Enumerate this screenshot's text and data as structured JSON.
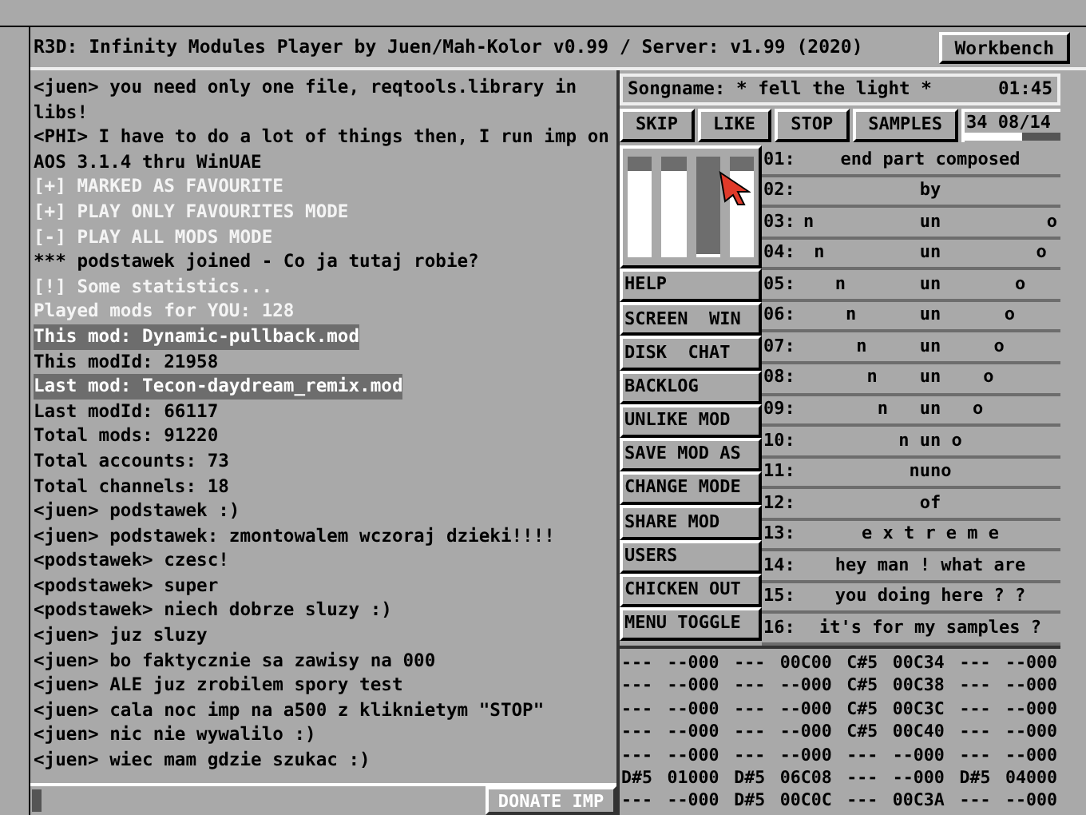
{
  "title_bar": {
    "title": "R3D: Infinity Modules Player by Juen/Mah-Kolor v0.99 / Server: v1.99 (2020)",
    "button": "Workbench"
  },
  "chat": {
    "lines": [
      {
        "kind": "normal",
        "text": "<juen> you need only one file, reqtools.library in libs!"
      },
      {
        "kind": "normal",
        "text": "<PHI> I have to do a lot of things then, I run imp on AOS 3.1.4 thru WinUAE"
      },
      {
        "kind": "system",
        "text": "[+] MARKED AS FAVOURITE"
      },
      {
        "kind": "system",
        "text": "[+] PLAY ONLY FAVOURITES MODE"
      },
      {
        "kind": "system",
        "text": "[-] PLAY ALL MODS MODE"
      },
      {
        "kind": "normal",
        "text": "*** podstawek joined - Co ja tutaj robie?"
      },
      {
        "kind": "system",
        "text": "[!] Some statistics..."
      },
      {
        "kind": "system",
        "text": "Played mods for YOU: 128"
      },
      {
        "kind": "highlight",
        "text": "This mod: Dynamic-pullback.mod"
      },
      {
        "kind": "normal",
        "text": "This modId: 21958"
      },
      {
        "kind": "highlight",
        "text": "Last mod: Tecon-daydream_remix.mod"
      },
      {
        "kind": "normal",
        "text": "Last modId: 66117"
      },
      {
        "kind": "normal",
        "text": "Total mods: 91220"
      },
      {
        "kind": "normal",
        "text": "Total accounts: 73"
      },
      {
        "kind": "normal",
        "text": "Total channels: 18"
      },
      {
        "kind": "normal",
        "text": "<juen> podstawek :)"
      },
      {
        "kind": "normal",
        "text": "<juen> podstawek: zmontowalem wczoraj dzieki!!!!"
      },
      {
        "kind": "normal",
        "text": "<podstawek> czesc!"
      },
      {
        "kind": "normal",
        "text": "<podstawek> super"
      },
      {
        "kind": "normal",
        "text": "<podstawek> niech dobrze sluzy :)"
      },
      {
        "kind": "normal",
        "text": "<juen> juz sluzy"
      },
      {
        "kind": "normal",
        "text": "<juen> bo faktycznie sa zawisy na 000"
      },
      {
        "kind": "normal",
        "text": "<juen> ALE juz zrobilem spory test"
      },
      {
        "kind": "normal",
        "text": "<juen> cala noc imp na a500 z kliknietym \"STOP\""
      },
      {
        "kind": "normal",
        "text": "<juen> nic nie wywalilo :)"
      },
      {
        "kind": "normal",
        "text": "<juen> wiec mam gdzie szukac :)"
      }
    ],
    "donate_button": "DONATE IMP"
  },
  "player": {
    "songname": "Songname: * fell the light *",
    "time": "01:45",
    "buttons": [
      "SKIP",
      "LIKE",
      "STOP",
      "SAMPLES"
    ],
    "position": {
      "text": "34 08/14",
      "level": 0.6
    },
    "meters": [
      {
        "level": 0.85
      },
      {
        "level": 0.85
      },
      {
        "level": 0
      },
      {
        "level": 0.85
      }
    ],
    "menu": [
      "HELP",
      "SCREEN  WIN",
      "DISK  CHAT",
      "BACKLOG",
      "UNLIKE MOD",
      "SAVE MOD AS",
      "CHANGE MODE",
      "SHARE MOD",
      "USERS",
      "CHICKEN OUT",
      "MENU TOGGLE"
    ],
    "samples": [
      {
        "number": "01:",
        "name": "end part composed"
      },
      {
        "number": "02:",
        "name": "by"
      },
      {
        "number": "03:",
        "name": "n          un          o"
      },
      {
        "number": "04:",
        "name": "n         un         o"
      },
      {
        "number": "05:",
        "name": "n       un       o"
      },
      {
        "number": "06:",
        "name": "n      un      o"
      },
      {
        "number": "07:",
        "name": "n     un     o"
      },
      {
        "number": "08:",
        "name": "n    un    o"
      },
      {
        "number": "09:",
        "name": "n   un   o"
      },
      {
        "number": "10:",
        "name": "n un o"
      },
      {
        "number": "11:",
        "name": "nuno"
      },
      {
        "number": "12:",
        "name": "of"
      },
      {
        "number": "13:",
        "name": "e x t r e m e"
      },
      {
        "number": "14:",
        "name": "hey man ! what are"
      },
      {
        "number": "15:",
        "name": "you doing here ? ?"
      },
      {
        "number": "16:",
        "name": "it's for my samples ?"
      }
    ]
  },
  "tracker": {
    "rows": [
      [
        "---",
        "--000",
        "---",
        "00C00",
        "C#5",
        "00C34",
        "---",
        "--000"
      ],
      [
        "---",
        "--000",
        "---",
        "--000",
        "C#5",
        "00C38",
        "---",
        "--000"
      ],
      [
        "---",
        "--000",
        "---",
        "--000",
        "C#5",
        "00C3C",
        "---",
        "--000"
      ],
      [
        "---",
        "--000",
        "---",
        "--000",
        "C#5",
        "00C40",
        "---",
        "--000"
      ],
      [
        "---",
        "--000",
        "---",
        "--000",
        "---",
        "--000",
        "---",
        "--000"
      ],
      [
        "D#5",
        "01000",
        "D#5",
        "06C08",
        "---",
        "--000",
        "D#5",
        "04000"
      ],
      [
        "---",
        "--000",
        "D#5",
        "00C0C",
        "---",
        "00C3A",
        "---",
        "--000"
      ]
    ]
  }
}
